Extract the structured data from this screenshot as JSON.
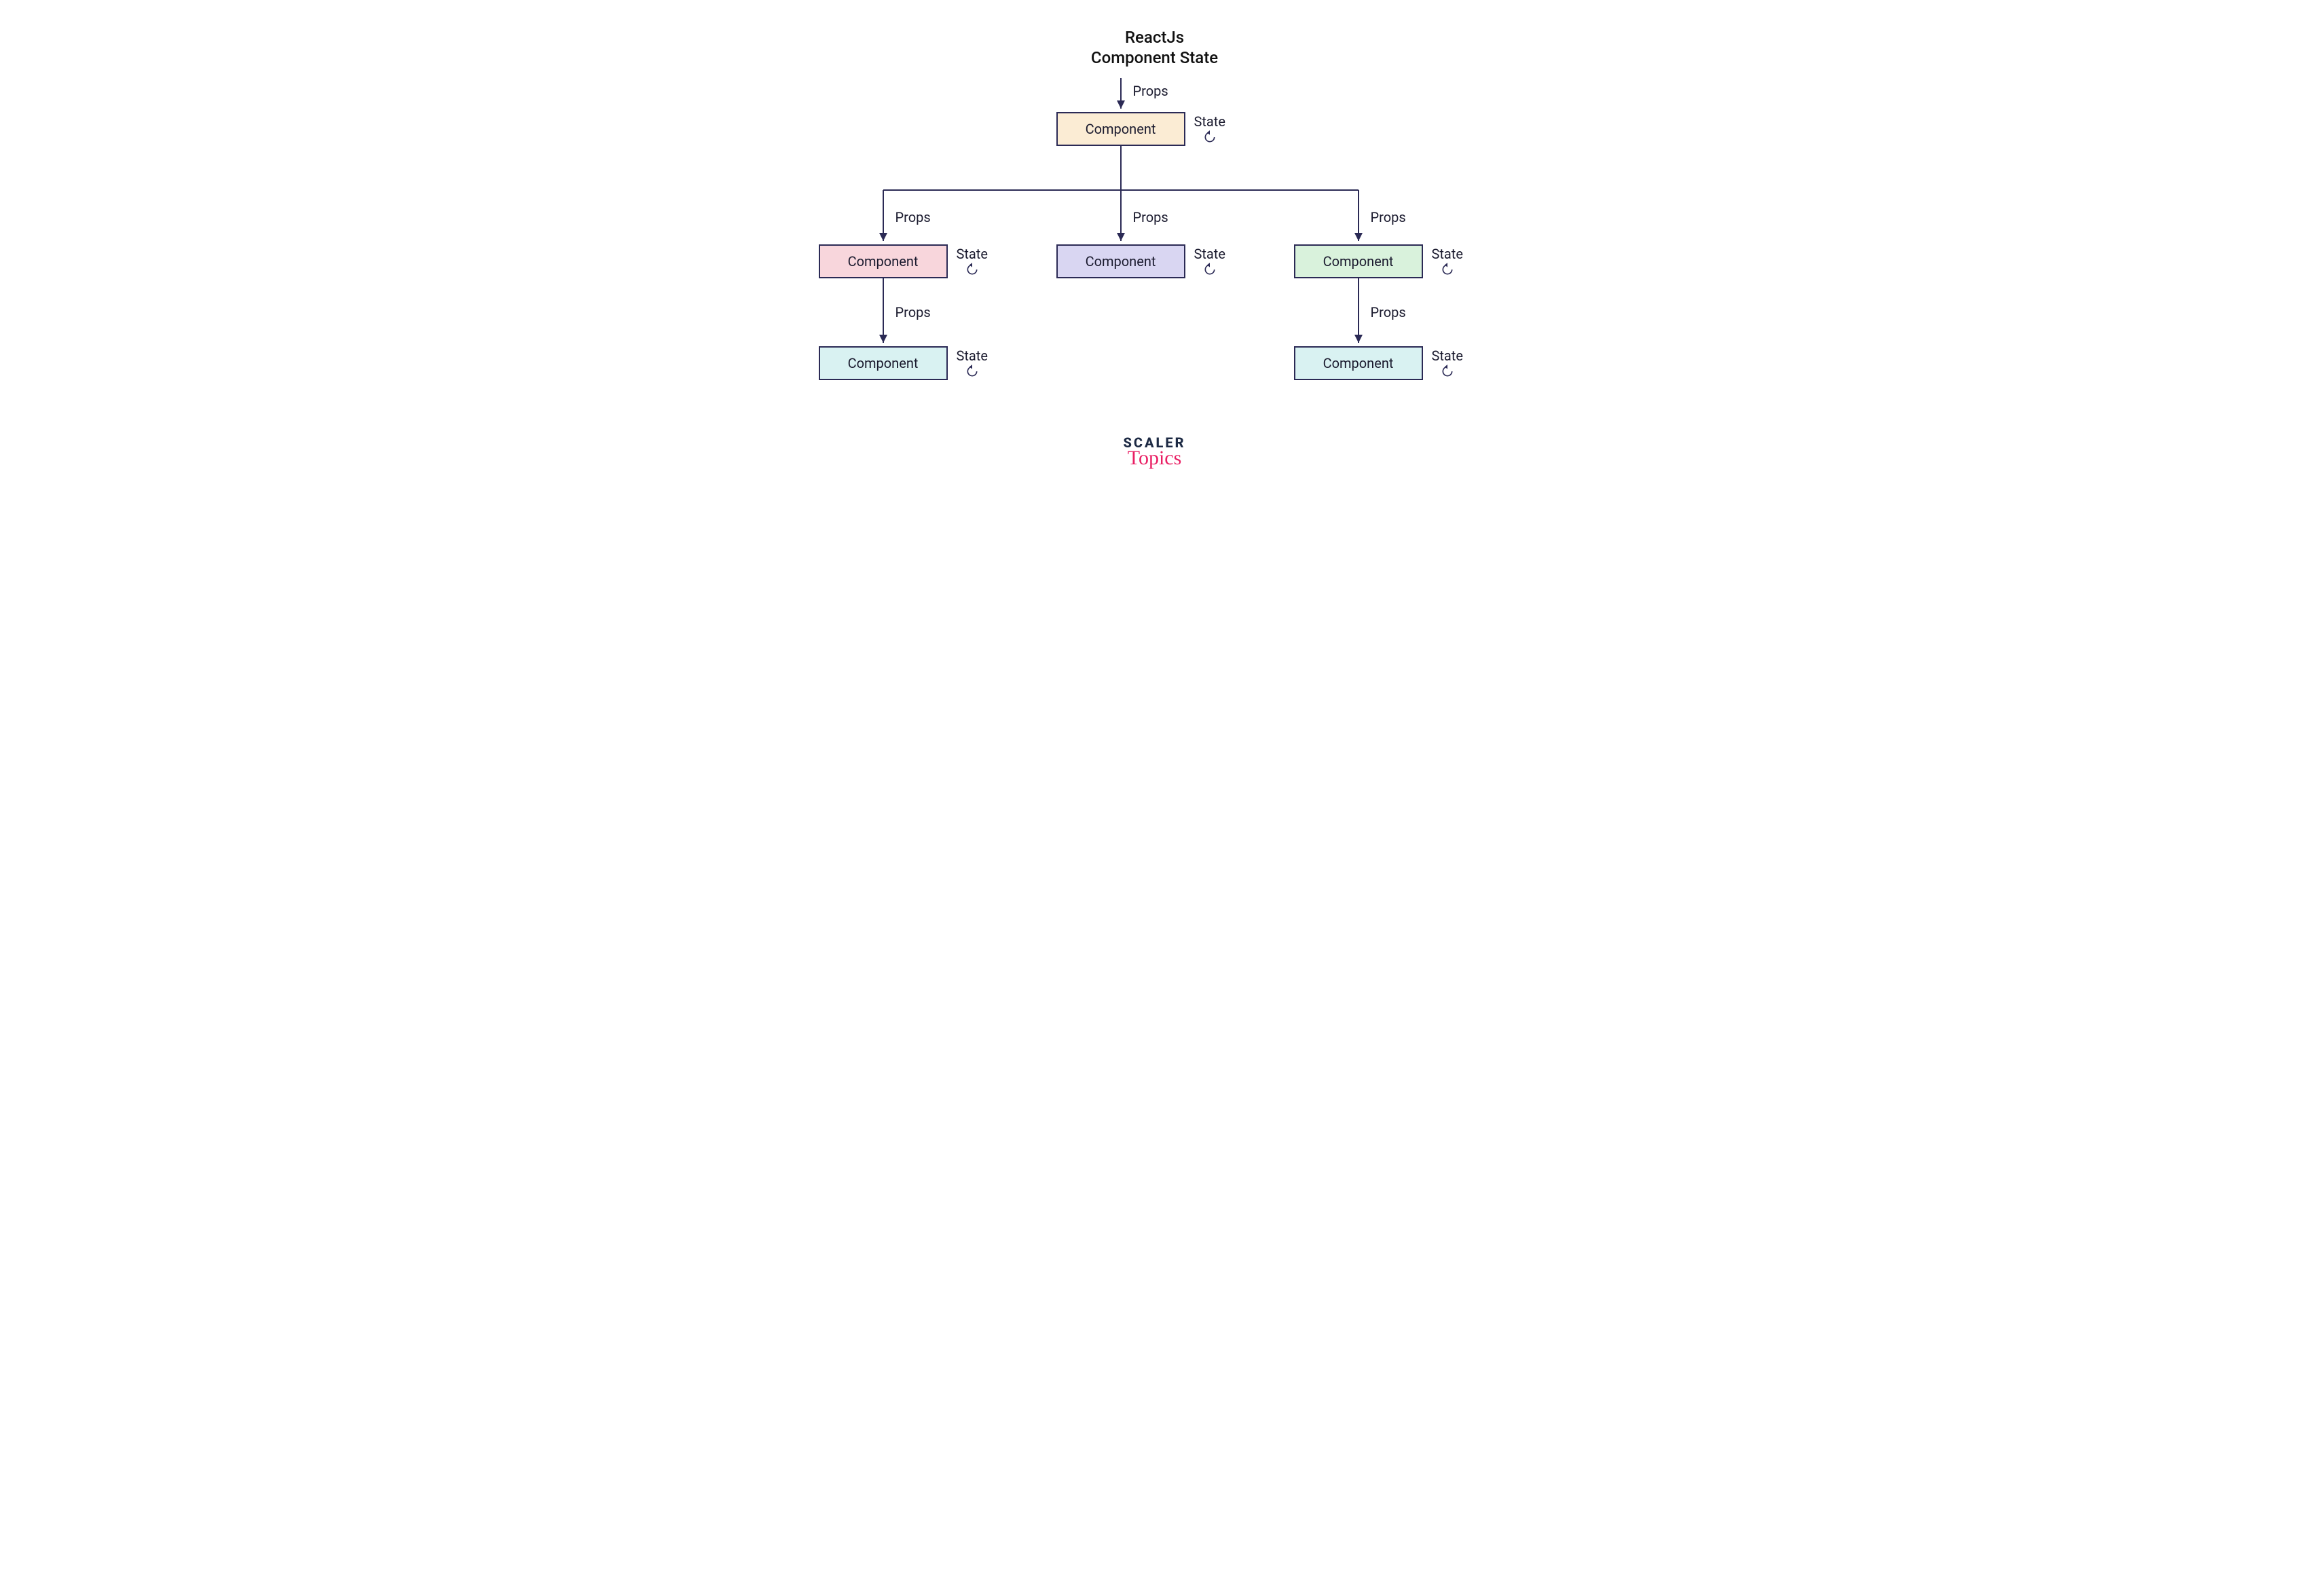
{
  "title_line1": "ReactJs",
  "title_line2": "Component State",
  "arrow_label": "Props",
  "state_label": "State",
  "nodes": {
    "root": {
      "text": "Component",
      "fill": "#fbecd4"
    },
    "left": {
      "text": "Component",
      "fill": "#f8d6dc"
    },
    "mid": {
      "text": "Component",
      "fill": "#d9d6f2"
    },
    "right": {
      "text": "Component",
      "fill": "#d9f2dc"
    },
    "lleaf": {
      "text": "Component",
      "fill": "#d9f2f2"
    },
    "rleaf": {
      "text": "Component",
      "fill": "#d9f2f2"
    }
  },
  "logo": {
    "line1": "SCALER",
    "line2": "Topics"
  },
  "colors": {
    "stroke": "#2b2a55"
  }
}
